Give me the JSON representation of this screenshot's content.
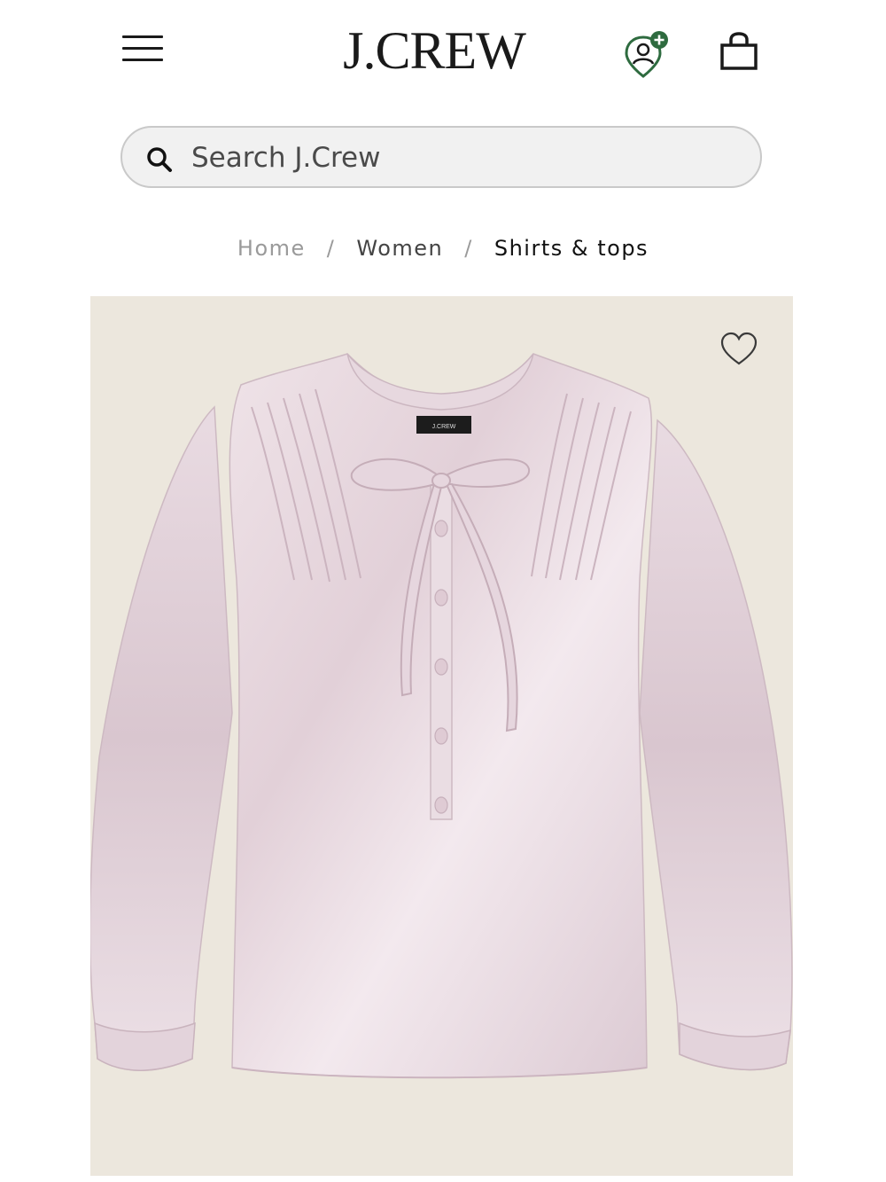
{
  "header": {
    "logo": "J.CREW",
    "menu_icon": "hamburger-menu-icon",
    "account_icon": "account-location-icon",
    "bag_icon": "shopping-bag-icon",
    "accent_color": "#2e6b3f"
  },
  "search": {
    "placeholder": "Search J.Crew",
    "value": ""
  },
  "breadcrumb": {
    "items": [
      {
        "label": "Home"
      },
      {
        "label": "Women"
      },
      {
        "label": "Shirts & tops"
      }
    ],
    "separator": "/"
  },
  "product": {
    "image_description_icon": "product-photo",
    "label_text": "J.CREW",
    "background_color": "#ece7dd",
    "garment_color": "#e6d9de",
    "wishlist_icon": "heart-icon"
  }
}
